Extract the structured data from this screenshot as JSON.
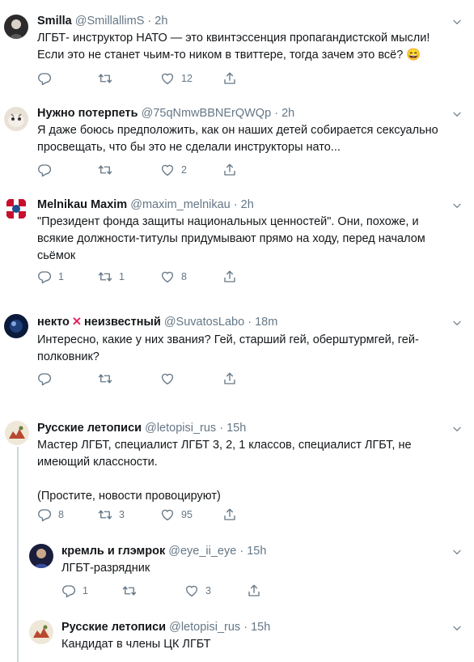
{
  "tweets": [
    {
      "name": "Smilla",
      "handle": "@SmillallimS",
      "time": "2h",
      "text": "ЛГБТ- инструктор НАТО — это квинтэссенция пропагандистской мысли!\nЕсли это не станет чьим-то ником в твиттере, тогда зачем это всё? 😄",
      "replies": "",
      "retweets": "",
      "likes": "12"
    },
    {
      "name": "Нужно потерпеть",
      "handle": "@75qNmwBBNErQWQp",
      "time": "2h",
      "text": "Я даже боюсь предположить, как он наших детей собирается сексуально\nпросвещать, что бы это не сделали инструкторы нато...",
      "replies": "",
      "retweets": "",
      "likes": "2"
    },
    {
      "name": "Melnikau Maxim",
      "handle": "@maxim_melnikau",
      "time": "2h",
      "text": "\"Президент фонда защиты национальных ценностей\". Они, похоже, и\nвсякие должности-титулы придумывают прямо на ходу, перед началом\nсьёмок",
      "replies": "1",
      "retweets": "1",
      "likes": "8"
    },
    {
      "name_part1": "некто",
      "name_mark": "✕",
      "name_part2": "неизвестный",
      "handle": "@SuvatosLabo",
      "time": "18m",
      "text": "Интересно, какие у них звания? Гей, старший гей, оберштурмгей, гей-\nполковник?",
      "replies": "",
      "retweets": "",
      "likes": ""
    },
    {
      "name": "Русские летописи",
      "handle": "@letopisi_rus",
      "time": "15h",
      "text": "Мастер ЛГБТ, специалист ЛГБТ 3, 2, 1 классов, специалист ЛГБТ, не\nимеющий классности.\n\n(Простите, новости провоцируют)",
      "replies": "8",
      "retweets": "3",
      "likes": "95"
    },
    {
      "name": "кремль и глэмрок",
      "handle": "@eye_ii_eye",
      "time": "15h",
      "text": "ЛГБТ-разрядник",
      "replies": "1",
      "retweets": "",
      "likes": "3"
    },
    {
      "name": "Русские летописи",
      "handle": "@letopisi_rus",
      "time": "15h",
      "text": "Кандидат в члены ЦК ЛГБТ",
      "replies": "",
      "retweets": "",
      "likes": ""
    }
  ],
  "separator": "·",
  "icons": {
    "reply": "reply-icon",
    "retweet": "retweet-icon",
    "like": "like-icon",
    "share": "share-icon",
    "caret": "chevron-down-icon"
  },
  "colors": {
    "text": "#14171a",
    "secondary": "#657786",
    "thread_line": "#ccd6dd",
    "x_mark": "#e0245e"
  }
}
